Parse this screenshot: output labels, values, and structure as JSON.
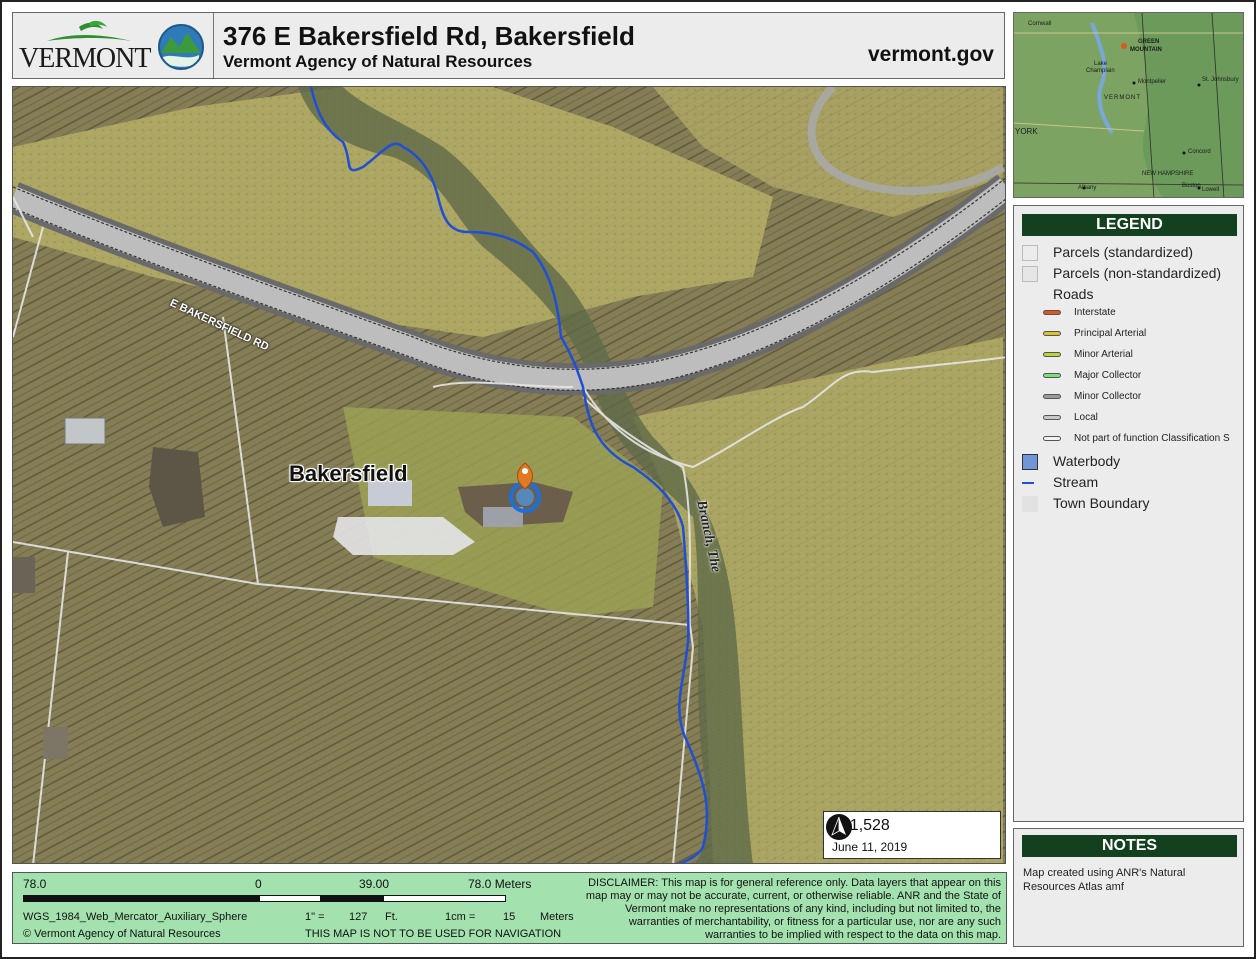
{
  "header": {
    "state_logo_text": "VERMONT",
    "title": "376 E Bakersfield Rd, Bakersfield",
    "subtitle": "Vermont Agency of Natural Resources",
    "site": "vermont.gov"
  },
  "map": {
    "road_label": "E BAKERSFIELD RD",
    "place_label": "Bakersfield",
    "stream_label": "Branch, The",
    "scale_ratio": "1:  1,528",
    "date": "June 11, 2019",
    "north_icon": "north-arrow-icon",
    "marker_icon": "location-pin-icon"
  },
  "overview": {
    "labels": [
      "Cornwall",
      "GREEN",
      "MOUNTAIN",
      "Lake",
      "Champlain",
      "Montpelier",
      "St. Johnsbury",
      "VERMONT",
      "YORK",
      "Concord",
      "NEW HAMPSHIRE",
      "Albany",
      "Boston",
      "Lowell"
    ]
  },
  "legend": {
    "title": "LEGEND",
    "parcels_std": "Parcels (standardized)",
    "parcels_nonstd": "Parcels (non-standardized)",
    "roads_heading": "Roads",
    "roads": [
      {
        "label": "Interstate",
        "color": "#e0571d"
      },
      {
        "label": "Principal Arterial",
        "color": "#d8c12a"
      },
      {
        "label": "Minor Arterial",
        "color": "#b9d43a"
      },
      {
        "label": "Major Collector",
        "color": "#7be07a"
      },
      {
        "label": "Minor Collector",
        "color": "#9a9a9a"
      },
      {
        "label": "Local",
        "color": "#c8c8c8"
      },
      {
        "label": "Not part of function Classification S",
        "color": "#f2f2f2"
      }
    ],
    "waterbody": "Waterbody",
    "stream": "Stream",
    "town_boundary": "Town Boundary",
    "waterbody_color": "#7096d8",
    "stream_color": "#1f4fd6"
  },
  "notes": {
    "title": "NOTES",
    "text": "Map created using ANR's Natural Resources Atlas amf"
  },
  "footer": {
    "sb_left": "78.0",
    "sb_zero": "0",
    "sb_mid": "39.00",
    "sb_right": "78.0 Meters",
    "projection": "WGS_1984_Web_Mercator_Auxiliary_Sphere",
    "inch_label": "1\" =",
    "inch_value": "127",
    "inch_unit": "Ft.",
    "cm_label": "1cm =",
    "cm_value": "15",
    "cm_unit": "Meters",
    "copyright": "© Vermont Agency of Natural Resources",
    "nav_warning": "THIS MAP IS NOT TO BE USED FOR NAVIGATION",
    "disclaimer": "DISCLAIMER: This map is for general reference only. Data layers that appear on this map may or may not be accurate, current, or otherwise reliable. ANR and the State of Vermont make no representations of any kind, including but not limited to, the warranties of merchantability, or fitness for a particular use, nor are any such warranties to be implied with respect to the data on this map."
  }
}
